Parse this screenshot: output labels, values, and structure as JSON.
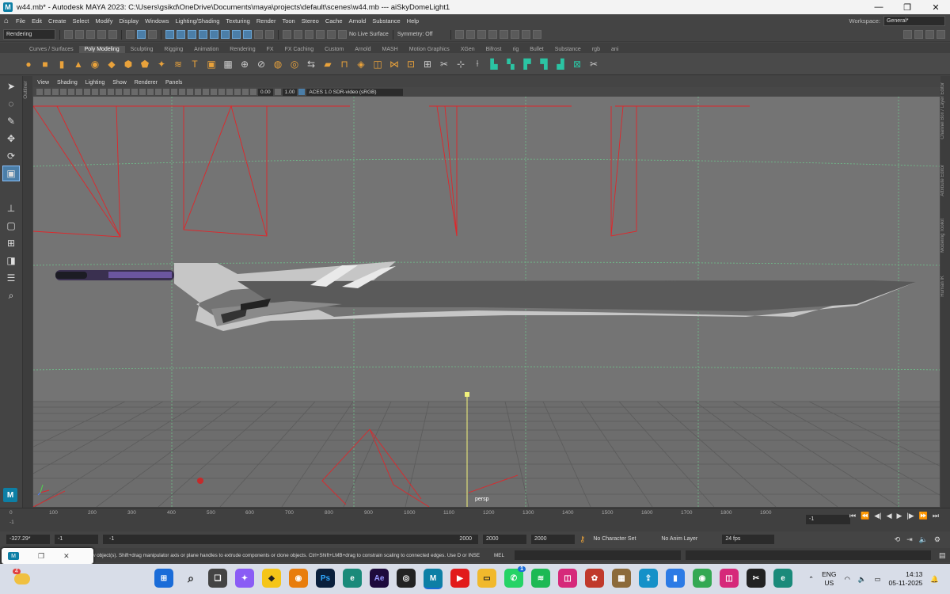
{
  "window": {
    "title": "w44.mb* - Autodesk MAYA 2023: C:\\Users\\gsikd\\OneDrive\\Documents\\maya\\projects\\default\\scenes\\w44.mb   ---   aiSkyDomeLight1",
    "app_icon": "M",
    "minimize": "—",
    "maximize": "❐",
    "close": "✕"
  },
  "menubar": {
    "items": [
      "File",
      "Edit",
      "Create",
      "Select",
      "Modify",
      "Display",
      "Windows",
      "Lighting/Shading",
      "Texturing",
      "Render",
      "Toon",
      "Stereo",
      "Cache",
      "Arnold",
      "Substance",
      "Help"
    ],
    "workspace_label": "Workspace:",
    "workspace_value": "General*"
  },
  "statusline": {
    "menuset": "Rendering",
    "live_surface": "No Live Surface",
    "symmetry": "Symmetry: Off"
  },
  "shelf": {
    "tabs": [
      "Curves / Surfaces",
      "Poly Modeling",
      "Sculpting",
      "Rigging",
      "Animation",
      "Rendering",
      "FX",
      "FX Caching",
      "Custom",
      "Arnold",
      "MASH",
      "Motion Graphics",
      "XGen",
      "Bifrost",
      "rig",
      "Bullet",
      "Substance",
      "rgb",
      "ani"
    ],
    "active_tab": "Poly Modeling"
  },
  "panel": {
    "menus": [
      "View",
      "Shading",
      "Lighting",
      "Show",
      "Renderer",
      "Panels"
    ],
    "exposure": "0.00",
    "gamma": "1.00",
    "colorspace": "ACES 1.0 SDR-video (sRGB)",
    "camera_label": "persp"
  },
  "right_tabs": [
    "Channel Box / Layer Editor",
    "Attribute Editor",
    "Modeling Toolkit",
    "Human IK"
  ],
  "outliner_tab": "Outliner",
  "timeslider": {
    "ticks": [
      "0",
      "100",
      "200",
      "300",
      "400",
      "500",
      "600",
      "700",
      "800",
      "900",
      "1000",
      "1100",
      "1200",
      "1300",
      "1400",
      "1500",
      "1600",
      "1700",
      "1800",
      "1900"
    ],
    "start_marker": "-1",
    "current_frame": "-1"
  },
  "rangeslider": {
    "current_time": "-327.29*",
    "start": "-1",
    "range_start": "-1",
    "range_end": "2000",
    "end": "2000",
    "anim_end": "2000",
    "character_set": "No Character Set",
    "anim_layer": "No Anim Layer",
    "fps": "24 fps"
  },
  "helpline": {
    "text": "w object(s). Shift+drag manipulator axis or plane handles to extrude components or clone objects. Ctrl+Shift+LMB+drag to constrain scaling to connected edges. Use D or INSERT",
    "mel_label": "MEL"
  },
  "taskbar": {
    "weather_badge": "4",
    "whatsapp_badge": "1",
    "lang": "ENG",
    "region": "US",
    "time": "14:13",
    "date": "05-11-2025"
  },
  "colors": {
    "accent": "#4b7ea8",
    "viewport_bg": "#747474",
    "camera_wire": "#e0262a",
    "grid_line": "#6fc18b"
  }
}
